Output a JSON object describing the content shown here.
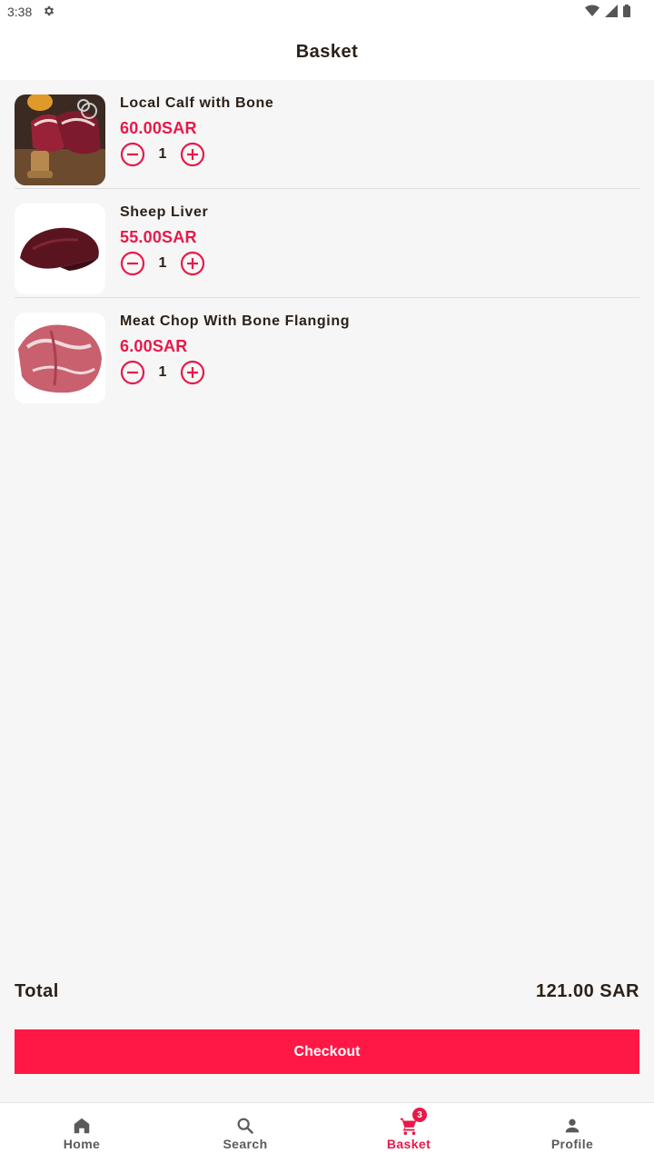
{
  "status_bar": {
    "time": "3:38"
  },
  "app_bar": {
    "title": "Basket"
  },
  "colors": {
    "accent": "#e8194a",
    "checkout": "#ff1845",
    "text": "#2b2118",
    "background": "#f6f6f6"
  },
  "basket": {
    "items": [
      {
        "name": "Local Calf with Bone",
        "price": "60.00SAR",
        "quantity": "1",
        "image": "calf-meat-image"
      },
      {
        "name": "Sheep Liver",
        "price": "55.00SAR",
        "quantity": "1",
        "image": "liver-image"
      },
      {
        "name": "Meat Chop With Bone Flanging",
        "price": "6.00SAR",
        "quantity": "1",
        "image": "meat-chop-image"
      }
    ]
  },
  "summary": {
    "total_label": "Total",
    "total_value": "121.00 SAR",
    "checkout_label": "Checkout"
  },
  "bottom_nav": {
    "items": [
      {
        "label": "Home",
        "icon": "home-icon"
      },
      {
        "label": "Search",
        "icon": "search-icon"
      },
      {
        "label": "Basket",
        "icon": "cart-icon",
        "badge": "3",
        "active": true
      },
      {
        "label": "Profile",
        "icon": "person-icon"
      }
    ]
  }
}
